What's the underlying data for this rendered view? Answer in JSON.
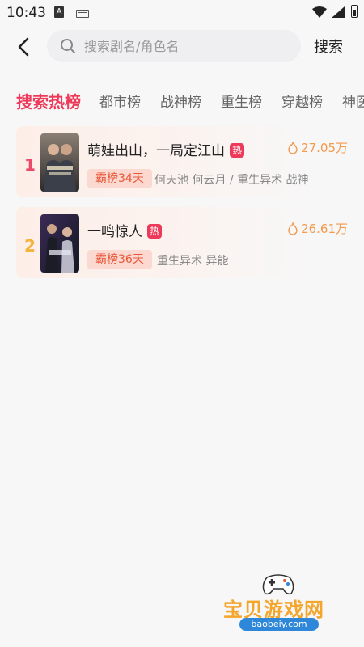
{
  "status_bar": {
    "time": "10:43",
    "a_icon_letter": "A"
  },
  "header": {
    "search_placeholder": "搜索剧名/角色名",
    "search_value": "",
    "search_button": "搜索"
  },
  "tabs": [
    {
      "label": "搜索热榜",
      "active": true
    },
    {
      "label": "都市榜",
      "active": false
    },
    {
      "label": "战神榜",
      "active": false
    },
    {
      "label": "重生榜",
      "active": false
    },
    {
      "label": "穿越榜",
      "active": false
    },
    {
      "label": "神医",
      "active": false
    }
  ],
  "list": [
    {
      "rank": "1",
      "title": "萌娃出山，一局定江山",
      "hot_label": "热",
      "heat": "27.05万",
      "chip": "霸榜34天",
      "tags": "何天池  何云月 / 重生异术 战神"
    },
    {
      "rank": "2",
      "title": "一鸣惊人",
      "hot_label": "热",
      "heat": "26.61万",
      "chip": "霸榜36天",
      "tags": "重生异术 异能"
    }
  ],
  "watermark": {
    "title": "宝贝游戏网",
    "url": "baobeiy.com"
  },
  "colors": {
    "accent": "#ee3a5a",
    "heat": "#f39a4c",
    "chip_text": "#e9573a"
  }
}
